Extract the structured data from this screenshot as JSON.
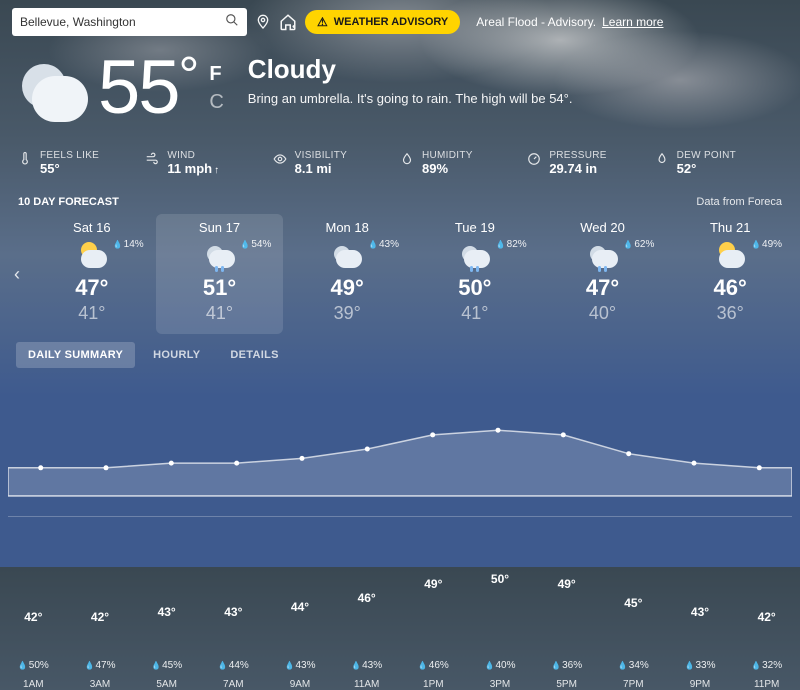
{
  "search": {
    "value": "Bellevue, Washington"
  },
  "advisory": {
    "badge": "WEATHER ADVISORY",
    "text": "Areal Flood - Advisory.",
    "learn": "Learn more"
  },
  "current": {
    "temp": "55",
    "deg": "°",
    "unit_f": "F",
    "unit_c": "C",
    "condition": "Cloudy",
    "summary": "Bring an umbrella. It's going to rain. The high will be 54°."
  },
  "metrics": {
    "feels": {
      "label": "FEELS LIKE",
      "value": "55°"
    },
    "wind": {
      "label": "WIND",
      "value": "11 mph"
    },
    "visibility": {
      "label": "VISIBILITY",
      "value": "8.1 mi"
    },
    "humidity": {
      "label": "HUMIDITY",
      "value": "89%"
    },
    "pressure": {
      "label": "PRESSURE",
      "value": "29.74 in"
    },
    "dew": {
      "label": "DEW POINT",
      "value": "52°"
    }
  },
  "forecast": {
    "title": "10 DAY FORECAST",
    "source": "Data from Foreca",
    "days": [
      {
        "name": "Sat 16",
        "precip": "14%",
        "hi": "47°",
        "lo": "41°",
        "icon": "partly-sunny"
      },
      {
        "name": "Sun 17",
        "precip": "54%",
        "hi": "51°",
        "lo": "41°",
        "icon": "rain"
      },
      {
        "name": "Mon 18",
        "precip": "43%",
        "hi": "49°",
        "lo": "39°",
        "icon": "cloudy"
      },
      {
        "name": "Tue 19",
        "precip": "82%",
        "hi": "50°",
        "lo": "41°",
        "icon": "rain"
      },
      {
        "name": "Wed 20",
        "precip": "62%",
        "hi": "47°",
        "lo": "40°",
        "icon": "rain"
      },
      {
        "name": "Thu 21",
        "precip": "49%",
        "hi": "46°",
        "lo": "36°",
        "icon": "partly-sunny"
      }
    ]
  },
  "tabs": {
    "daily": "DAILY SUMMARY",
    "hourly": "HOURLY",
    "details": "DETAILS"
  },
  "chart_data": {
    "type": "area",
    "title": "",
    "xlabel": "",
    "ylabel": "",
    "ylim": [
      36,
      56
    ],
    "x": [
      "1AM",
      "3AM",
      "5AM",
      "7AM",
      "9AM",
      "11AM",
      "1PM",
      "3PM",
      "5PM",
      "7PM",
      "9PM",
      "11PM"
    ],
    "series": [
      {
        "name": "Temperature (°F)",
        "values": [
          42,
          42,
          43,
          43,
          44,
          46,
          49,
          50,
          49,
          45,
          43,
          42
        ]
      },
      {
        "name": "Precipitation (%)",
        "values": [
          50,
          47,
          45,
          44,
          43,
          43,
          46,
          40,
          36,
          34,
          33,
          32
        ]
      }
    ]
  }
}
